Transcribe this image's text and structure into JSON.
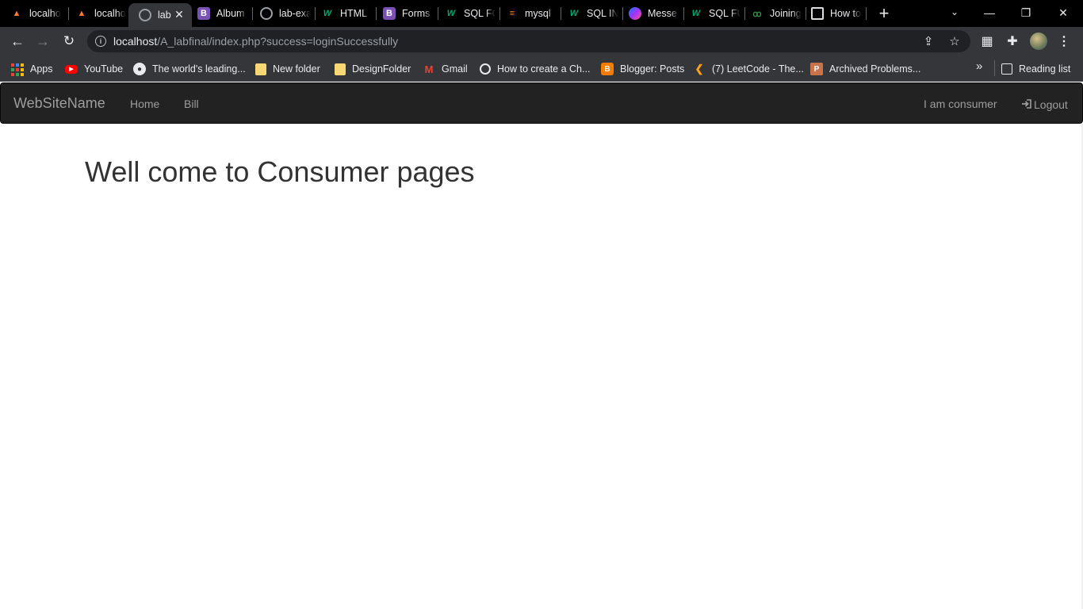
{
  "browser": {
    "tabs": [
      {
        "title": "localhost",
        "favicon": "xampp-icon"
      },
      {
        "title": "localhost",
        "favicon": "xampp-icon"
      },
      {
        "title": "lab",
        "favicon": "globe-icon",
        "active": true
      },
      {
        "title": "Album",
        "favicon": "bootstrap-icon"
      },
      {
        "title": "lab-exam",
        "favicon": "globe-icon"
      },
      {
        "title": "HTML",
        "favicon": "w3schools-icon"
      },
      {
        "title": "Forms",
        "favicon": "bootstrap-icon"
      },
      {
        "title": "SQL FO",
        "favicon": "w3schools-icon"
      },
      {
        "title": "mysql",
        "favicon": "stackoverflow-icon"
      },
      {
        "title": "SQL IN",
        "favicon": "w3schools-icon"
      },
      {
        "title": "Messe",
        "favicon": "messenger-icon"
      },
      {
        "title": "SQL FU",
        "favicon": "w3schools-icon"
      },
      {
        "title": "Joining",
        "favicon": "geeksforgeeks-icon"
      },
      {
        "title": "How to",
        "favicon": "code-icon"
      }
    ],
    "url_host": "localhost",
    "url_path": "/A_labfinal/index.php?success=loginSuccessfully",
    "bookmarks": [
      {
        "label": "Apps",
        "icon": "apps-grid-icon"
      },
      {
        "label": "YouTube",
        "icon": "youtube-icon"
      },
      {
        "label": "The world's leading...",
        "icon": "github-icon"
      },
      {
        "label": "New folder",
        "icon": "folder-icon"
      },
      {
        "label": "DesignFolder",
        "icon": "folder-icon"
      },
      {
        "label": "Gmail",
        "icon": "gmail-icon"
      },
      {
        "label": "How to create a Ch...",
        "icon": "chatgpt-icon"
      },
      {
        "label": "Blogger: Posts",
        "icon": "blogger-icon"
      },
      {
        "label": "(7) LeetCode - The...",
        "icon": "leetcode-icon"
      },
      {
        "label": "Archived Problems...",
        "icon": "archive-icon"
      }
    ],
    "more_bookmarks": "»",
    "reading_list": "Reading list",
    "colors": {
      "tabstrip": "#000000",
      "toolbar": "#35363a",
      "omnibox": "#202124"
    }
  },
  "site": {
    "brand": "WebSiteName",
    "nav": {
      "home": "Home",
      "bill": "Bill"
    },
    "user_label": "I am consumer",
    "logout": "Logout",
    "heading": "Well come to Consumer pages",
    "colors": {
      "navbar": "#222222",
      "navtext": "#9d9d9d",
      "heading": "#333333"
    }
  }
}
